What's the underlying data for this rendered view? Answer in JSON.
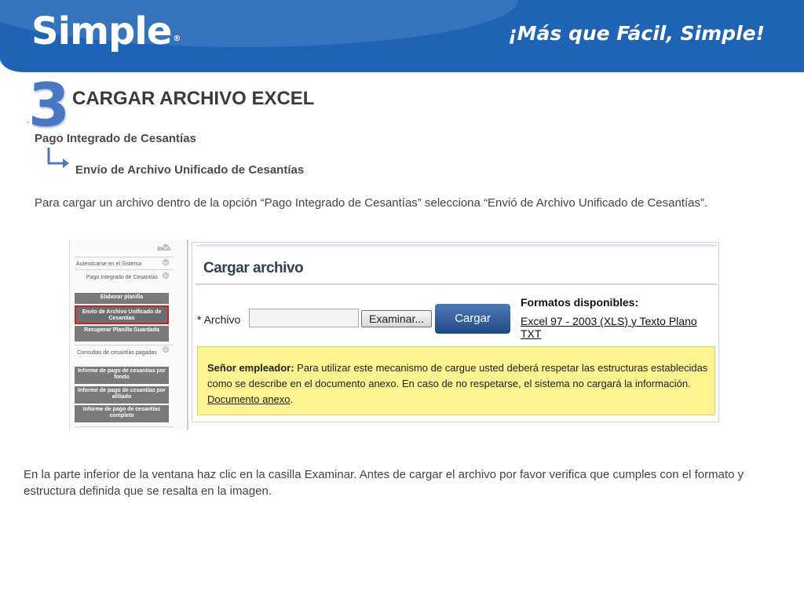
{
  "header": {
    "logo": "Simple",
    "logo_mark": "®",
    "slogan": "¡Más que Fácil, Simple!"
  },
  "step": {
    "number": "3",
    "bullet": "·",
    "title": "CARGAR ARCHIVO EXCEL"
  },
  "breadcrumb": {
    "level1": "Pago Integrado de Cesantías",
    "level2": "Envío de Archivo Unificado de Cesantías"
  },
  "intro_text": "Para cargar un archivo dentro de la opción “Pago Integrado de Cesantías” selecciona “Envió de Archivo Unificado de Cesantías”.",
  "menu": {
    "inicio": "Inicio",
    "autenticarse": "Autenticarse en el Sistema",
    "pago_integrado": "Pago Integrado de Cesantías",
    "elaborar": "Elaborar planilla",
    "envio": "Envío de Archivo Unificado de Cesantías",
    "recuperar": "Recuperar Planilla Guardada",
    "consultas": "Consultas de cesantías pagadas",
    "informe_fondo": "Informe de pago de cesantías por fondo",
    "informe_afiliado": "Informe de pago de cesantías por afiliado",
    "informe_completo": "Informe de pago de cesantías completo"
  },
  "upload": {
    "title": "Cargar archivo",
    "field_label": "* Archivo",
    "file_value": "",
    "browse_label": "Examinar...",
    "load_label": "Cargar",
    "formats_title": "Formatos disponibles:",
    "formats_value": "Excel 97 - 2003 (XLS) y Texto Plano TXT",
    "notice_bold": "Señor empleador:",
    "notice_text": " Para utilizar este mecanismo de cargue usted deberá respetar las estructuras establecidas como se describe en el documento anexo. En caso de no respetarse, el sistema no cargará la información. ",
    "notice_link": "Documento anexo",
    "notice_end": "."
  },
  "footer_text": "En la parte inferior de la ventana haz clic en la casilla Examinar. Antes de cargar el archivo  por favor verifica que cumples con el formato y estructura definida que se resalta en la imagen.",
  "colors": {
    "header_blue": "#1f64b4",
    "step_blue": "#4a76c2",
    "notice_yellow": "#fbf290",
    "highlight_red": "#d42020"
  }
}
